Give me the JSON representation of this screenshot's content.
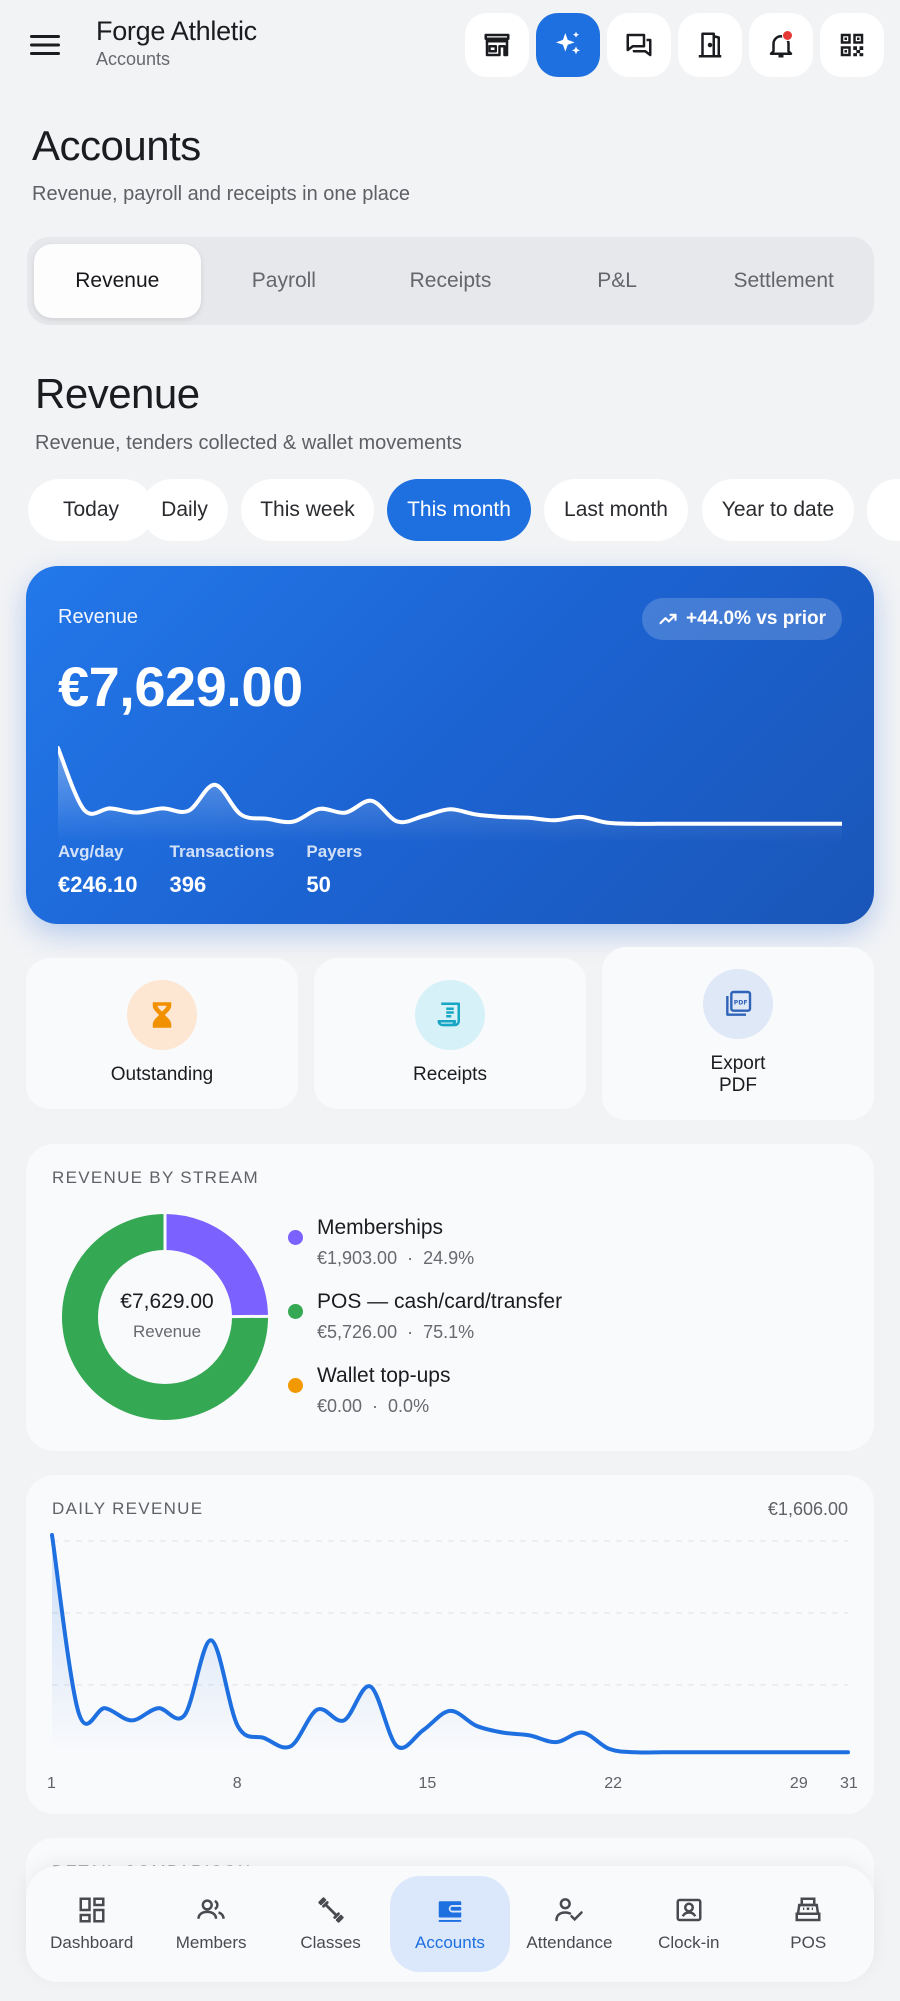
{
  "app": {
    "title": "Forge Athletic",
    "subtitle": "Accounts"
  },
  "top_actions": [
    {
      "icon": "store-icon",
      "label": "Store"
    },
    {
      "icon": "sparkle-icon",
      "label": "Assistant",
      "active": true
    },
    {
      "icon": "chat-icon",
      "label": "Messages"
    },
    {
      "icon": "door-icon",
      "label": "Door"
    },
    {
      "icon": "bell-icon",
      "label": "Notifications",
      "has_badge": true
    },
    {
      "icon": "qr-code-icon",
      "label": "QR code"
    }
  ],
  "page": {
    "title": "Accounts",
    "subtitle": "Revenue, payroll and receipts in one place"
  },
  "tabs": [
    {
      "label": "Revenue",
      "active": true
    },
    {
      "label": "Payroll"
    },
    {
      "label": "Receipts"
    },
    {
      "label": "P&L"
    },
    {
      "label": "Settlement"
    }
  ],
  "section": {
    "title": "Revenue",
    "subtitle": "Revenue, tenders collected & wallet movements"
  },
  "periods": [
    {
      "label": "Today"
    },
    {
      "label": "Daily"
    },
    {
      "label": "This week"
    },
    {
      "label": "This month",
      "active": true
    },
    {
      "label": "Last month"
    },
    {
      "label": "Year to date"
    }
  ],
  "hero": {
    "label": "Revenue",
    "change": "+44.0% vs prior",
    "amount": "€7,629.00",
    "stats": [
      {
        "label": "Avg/day",
        "value": "€246.10"
      },
      {
        "label": "Transactions",
        "value": "396"
      },
      {
        "label": "Payers",
        "value": "50"
      }
    ]
  },
  "quick_actions": [
    {
      "label": "Outstanding",
      "icon": "hourglass-icon"
    },
    {
      "label": "Receipts",
      "icon": "receipt-icon"
    },
    {
      "label_line1": "Export",
      "label_line2": "PDF",
      "icon": "pdf-icon"
    }
  ],
  "stream": {
    "title": "REVENUE BY STREAM",
    "total": "€7,629.00",
    "total_label": "Revenue",
    "items": [
      {
        "name": "Memberships",
        "amount": "€1,903.00",
        "percent": "24.9%",
        "share": 24.9,
        "color": "#7b61ff"
      },
      {
        "name": "POS — cash/card/transfer",
        "amount": "€5,726.00",
        "percent": "75.1%",
        "share": 75.1,
        "color": "#34a853"
      },
      {
        "name": "Wallet top-ups",
        "amount": "€0.00",
        "percent": "0.0%",
        "share": 0.0,
        "color": "#f29900"
      }
    ]
  },
  "daily": {
    "title": "DAILY REVENUE",
    "max_label": "€1,606.00",
    "x_ticks": [
      "1",
      "8",
      "15",
      "22",
      "29",
      "31"
    ]
  },
  "next_card_title": "DETAIL COMPARISON",
  "chart_data": {
    "type": "line",
    "title": "DAILY REVENUE",
    "xlabel": "",
    "ylabel": "",
    "x": [
      1,
      2,
      3,
      4,
      5,
      6,
      7,
      8,
      9,
      10,
      11,
      12,
      13,
      14,
      15,
      16,
      17,
      18,
      19,
      20,
      21,
      22,
      23,
      24,
      25,
      26,
      27,
      28,
      29,
      30,
      31
    ],
    "values": [
      1606,
      300,
      330,
      240,
      330,
      280,
      830,
      200,
      110,
      50,
      320,
      240,
      490,
      50,
      170,
      310,
      200,
      150,
      130,
      80,
      150,
      30,
      5,
      5,
      5,
      5,
      5,
      5,
      5,
      5,
      5
    ],
    "ylim": [
      0,
      1606
    ],
    "grid": true,
    "color": "#1e6fe0"
  },
  "nav": [
    {
      "label": "Dashboard",
      "icon": "dashboard-icon"
    },
    {
      "label": "Members",
      "icon": "members-icon"
    },
    {
      "label": "Classes",
      "icon": "dumbbell-icon"
    },
    {
      "label": "Accounts",
      "icon": "accounts-icon",
      "active": true
    },
    {
      "label": "Attendance",
      "icon": "attendance-icon"
    },
    {
      "label": "Clock-in",
      "icon": "clock-in-icon"
    },
    {
      "label": "POS",
      "icon": "pos-icon"
    }
  ]
}
